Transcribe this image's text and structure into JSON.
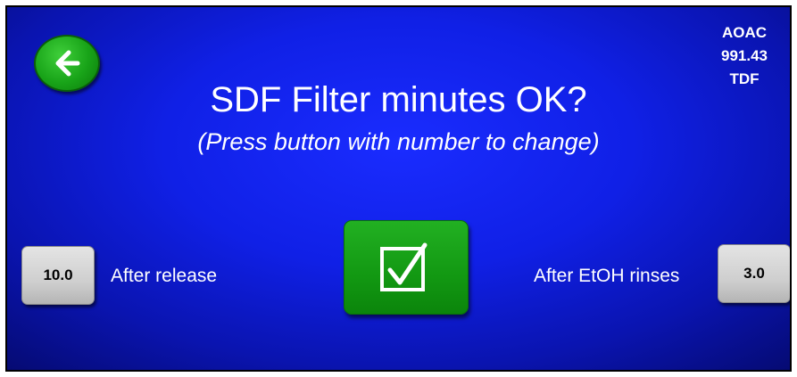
{
  "header": {
    "back_icon": "arrow-left-icon",
    "method_line1": "AOAC",
    "method_line2": "991.43",
    "method_line3": "TDF"
  },
  "prompt": {
    "title": "SDF Filter minutes OK?",
    "subtitle": "(Press button with number to change)"
  },
  "settings": {
    "after_release_value": "10.0",
    "after_release_label": "After release",
    "after_etoh_value": "3.0",
    "after_etoh_label": "After EtOH rinses"
  },
  "confirm": {
    "icon": "checkbox-check-icon"
  },
  "colors": {
    "background": "#1020e6",
    "green_button": "#129812",
    "gray_button": "#cfcfcf"
  }
}
